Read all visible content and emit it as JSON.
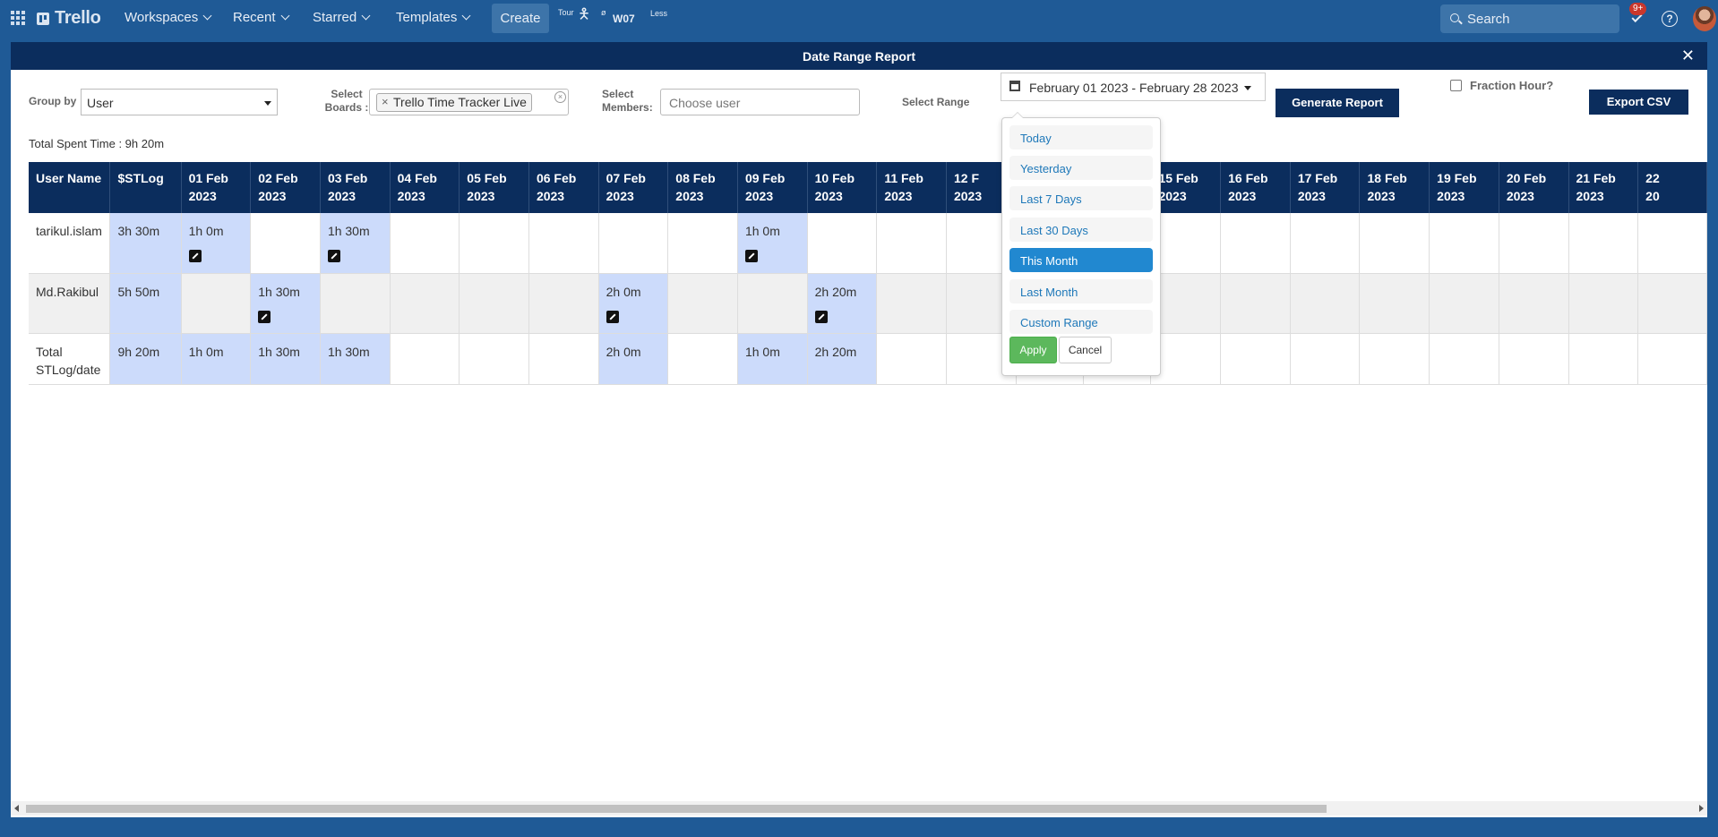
{
  "topbar": {
    "logo": "Trello",
    "nav": [
      {
        "label": "Workspaces"
      },
      {
        "label": "Recent"
      },
      {
        "label": "Starred"
      },
      {
        "label": "Templates"
      }
    ],
    "create_label": "Create",
    "tour_label": "Tour",
    "ext_sym": "ø",
    "ext_label": "W07",
    "less_label": "Less",
    "search_placeholder": "Search",
    "notif_badge": "9+",
    "help_label": "?"
  },
  "modal": {
    "title": "Date Range Report",
    "close": "✕"
  },
  "filters": {
    "group_by_label": "Group by",
    "group_by_value": "User",
    "boards_label_1": "Select",
    "boards_label_2": "Boards :",
    "board_chip": "Trello Time Tracker Live",
    "chip_remove": "×",
    "clear_all": "×",
    "members_label_1": "Select",
    "members_label_2": "Members:",
    "members_placeholder": "Choose user",
    "range_label": "Select Range",
    "range_value": "February 01 2023 - February 28 2023",
    "generate_label": "Generate Report",
    "fraction_label": "Fraction Hour?",
    "export_label": "Export CSV"
  },
  "summary": {
    "total_spent": "Total Spent Time : 9h 20m"
  },
  "table": {
    "headers": [
      {
        "l1": "User Name",
        "l2": ""
      },
      {
        "l1": "$STLog",
        "l2": ""
      },
      {
        "l1": "01 Feb",
        "l2": "2023"
      },
      {
        "l1": "02 Feb",
        "l2": "2023"
      },
      {
        "l1": "03 Feb",
        "l2": "2023"
      },
      {
        "l1": "04 Feb",
        "l2": "2023"
      },
      {
        "l1": "05 Feb",
        "l2": "2023"
      },
      {
        "l1": "06 Feb",
        "l2": "2023"
      },
      {
        "l1": "07 Feb",
        "l2": "2023"
      },
      {
        "l1": "08 Feb",
        "l2": "2023"
      },
      {
        "l1": "09 Feb",
        "l2": "2023"
      },
      {
        "l1": "10 Feb",
        "l2": "2023"
      },
      {
        "l1": "11 Feb",
        "l2": "2023"
      },
      {
        "l1": "12 F",
        "l2": "2023"
      },
      {
        "l1": "",
        "l2": ""
      },
      {
        "l1": "",
        "l2": ""
      },
      {
        "l1": "15 Feb",
        "l2": "2023"
      },
      {
        "l1": "16 Feb",
        "l2": "2023"
      },
      {
        "l1": "17 Feb",
        "l2": "2023"
      },
      {
        "l1": "18 Feb",
        "l2": "2023"
      },
      {
        "l1": "19 Feb",
        "l2": "2023"
      },
      {
        "l1": "20 Feb",
        "l2": "2023"
      },
      {
        "l1": "21 Feb",
        "l2": "2023"
      },
      {
        "l1": "22",
        "l2": "20"
      }
    ],
    "rows": [
      {
        "name": "tarikul.islam",
        "cells": [
          {
            "t": "3h 30m",
            "hl": true
          },
          {
            "t": "1h 0m",
            "hl": true,
            "edit": true
          },
          {
            "t": ""
          },
          {
            "t": "1h 30m",
            "hl": true,
            "edit": true
          },
          {
            "t": ""
          },
          {
            "t": ""
          },
          {
            "t": ""
          },
          {
            "t": ""
          },
          {
            "t": ""
          },
          {
            "t": "1h 0m",
            "hl": true,
            "edit": true
          },
          {
            "t": ""
          },
          {
            "t": ""
          },
          {
            "t": ""
          },
          {
            "t": ""
          },
          {
            "t": ""
          },
          {
            "t": ""
          },
          {
            "t": ""
          },
          {
            "t": ""
          },
          {
            "t": ""
          },
          {
            "t": ""
          },
          {
            "t": ""
          },
          {
            "t": ""
          },
          {
            "t": ""
          }
        ]
      },
      {
        "name": "Md.Rakibul",
        "cells": [
          {
            "t": "5h 50m",
            "hl": true
          },
          {
            "t": ""
          },
          {
            "t": "1h 30m",
            "hl": true,
            "edit": true
          },
          {
            "t": ""
          },
          {
            "t": ""
          },
          {
            "t": ""
          },
          {
            "t": ""
          },
          {
            "t": "2h 0m",
            "hl": true,
            "edit": true
          },
          {
            "t": ""
          },
          {
            "t": ""
          },
          {
            "t": "2h 20m",
            "hl": true,
            "edit": true
          },
          {
            "t": ""
          },
          {
            "t": ""
          },
          {
            "t": ""
          },
          {
            "t": ""
          },
          {
            "t": ""
          },
          {
            "t": ""
          },
          {
            "t": ""
          },
          {
            "t": ""
          },
          {
            "t": ""
          },
          {
            "t": ""
          },
          {
            "t": ""
          },
          {
            "t": ""
          }
        ]
      },
      {
        "name": "Total\nSTLog/date",
        "cells": [
          {
            "t": "9h 20m",
            "hl": true
          },
          {
            "t": "1h 0m",
            "hl": true
          },
          {
            "t": "1h 30m",
            "hl": true
          },
          {
            "t": "1h 30m",
            "hl": true
          },
          {
            "t": ""
          },
          {
            "t": ""
          },
          {
            "t": ""
          },
          {
            "t": "2h 0m",
            "hl": true
          },
          {
            "t": ""
          },
          {
            "t": "1h 0m",
            "hl": true
          },
          {
            "t": "2h 20m",
            "hl": true
          },
          {
            "t": ""
          },
          {
            "t": ""
          },
          {
            "t": ""
          },
          {
            "t": ""
          },
          {
            "t": ""
          },
          {
            "t": ""
          },
          {
            "t": ""
          },
          {
            "t": ""
          },
          {
            "t": ""
          },
          {
            "t": ""
          },
          {
            "t": ""
          },
          {
            "t": ""
          }
        ]
      }
    ]
  },
  "range_dropdown": {
    "items": [
      {
        "label": "Today"
      },
      {
        "label": "Yesterday"
      },
      {
        "label": "Last 7 Days"
      },
      {
        "label": "Last 30 Days"
      },
      {
        "label": "This Month",
        "active": true
      },
      {
        "label": "Last Month"
      },
      {
        "label": "Custom Range"
      }
    ],
    "apply_label": "Apply",
    "cancel_label": "Cancel"
  },
  "colors": {
    "brand_bar": "#1f5a96",
    "header_navy": "#0b2d5d",
    "highlight_cell": "#ccdbfb",
    "active_range": "#2188d0",
    "apply_green": "#5cb85c"
  }
}
